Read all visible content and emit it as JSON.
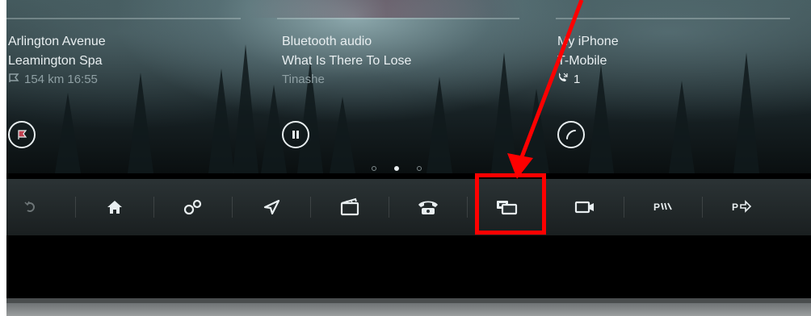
{
  "cards": [
    {
      "line1": "Arlington Avenue",
      "line2": "Leamington Spa",
      "meta": "154 km 16:55",
      "action_icon": "navigation-flag-icon"
    },
    {
      "line1": "Bluetooth audio",
      "line2": "What Is There To Lose",
      "meta": "Tinashe",
      "action_icon": "pause-icon"
    },
    {
      "line1": "My iPhone",
      "line2": "T-Mobile",
      "meta": "1",
      "action_icon": "phone-icon"
    }
  ],
  "page_indicator": {
    "count": 3,
    "active": 1
  },
  "toolbar": [
    {
      "name": "back-icon"
    },
    {
      "name": "home-icon"
    },
    {
      "name": "connected-devices-icon"
    },
    {
      "name": "navigation-icon"
    },
    {
      "name": "media-icon"
    },
    {
      "name": "phone-icon"
    },
    {
      "name": "screen-mirror-icon",
      "highlighted": true
    },
    {
      "name": "camera-icon"
    },
    {
      "name": "park-assist-icon"
    },
    {
      "name": "park-exit-icon"
    }
  ],
  "annotation": {
    "color": "#ff0000",
    "target": "screen-mirror-icon"
  },
  "colors": {
    "text": "#e8eef0",
    "subtext": "#8fa0a4",
    "toolbar": "#2b3335"
  }
}
